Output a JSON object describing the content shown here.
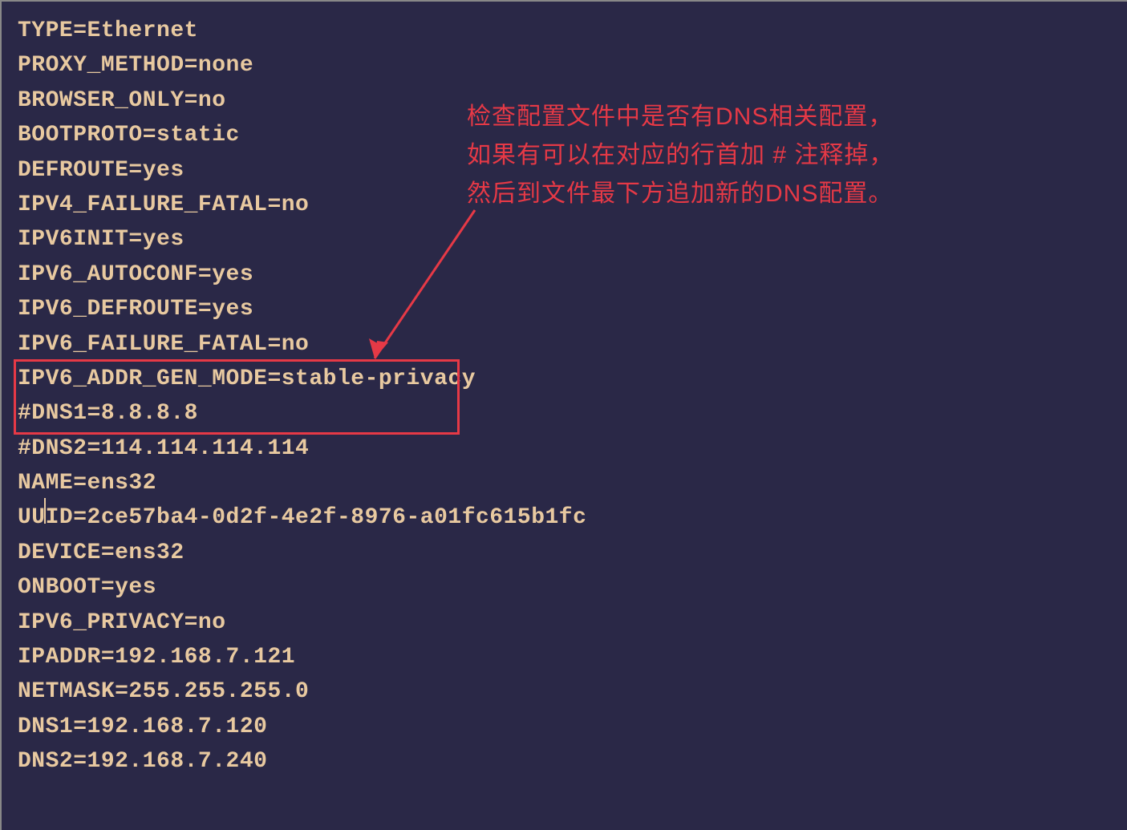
{
  "terminal": {
    "lines": [
      "TYPE=Ethernet",
      "PROXY_METHOD=none",
      "BROWSER_ONLY=no",
      "BOOTPROTO=static",
      "DEFROUTE=yes",
      "IPV4_FAILURE_FATAL=no",
      "IPV6INIT=yes",
      "IPV6_AUTOCONF=yes",
      "IPV6_DEFROUTE=yes",
      "IPV6_FAILURE_FATAL=no",
      "IPV6_ADDR_GEN_MODE=stable-privacy",
      "#DNS1=8.8.8.8",
      "#DNS2=114.114.114.114",
      "NAME=ens32",
      "UUID=2ce57ba4-0d2f-4e2f-8976-a01fc615b1fc",
      "DEVICE=ens32",
      "ONBOOT=yes",
      "IPV6_PRIVACY=no",
      "IPADDR=192.168.7.121",
      "NETMASK=255.255.255.0",
      "DNS1=192.168.7.120",
      "DNS2=192.168.7.240"
    ]
  },
  "annotation": {
    "line1": "检查配置文件中是否有DNS相关配置，",
    "line2": "如果有可以在对应的行首加 # 注释掉，",
    "line3": "然后到文件最下方追加新的DNS配置。"
  }
}
